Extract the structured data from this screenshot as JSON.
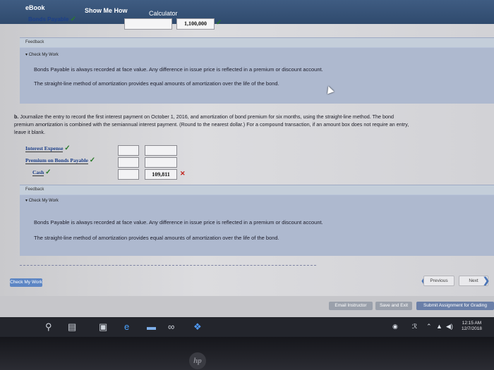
{
  "topbar": {
    "ebook": "eBook",
    "show_me_how": "Show Me How",
    "calculator": "Calculator"
  },
  "prev_entry": {
    "label": "Bonds Payable",
    "amount": "1,100,000"
  },
  "feedback_a": {
    "header": "Feedback",
    "check_my_work": "Check My Work",
    "line1": "Bonds Payable is always recorded at face value. Any difference in issue price is reflected in a premium or discount account.",
    "line2": "The straight-line method of amortization provides equal amounts of amortization over the life of the bond."
  },
  "question_b": {
    "prefix": "b.",
    "line1": "Journalize the entry to record the first interest payment on October 1, 2016, and amortization of bond premium for six months, using the straight-line method. The bond",
    "line2": "premium amortization is combined with the semiannual interest payment. (Round to the nearest dollar.) For a compound transaction, if an amount box does not require an entry,",
    "line3": "leave it blank."
  },
  "journal": {
    "rows": [
      {
        "account": "Interest Expense",
        "debit": "",
        "credit": ""
      },
      {
        "account": "Premium on Bonds Payable",
        "debit": "",
        "credit": ""
      },
      {
        "account": "Cash",
        "debit": "",
        "credit": "109,811"
      }
    ]
  },
  "feedback_b": {
    "header": "Feedback",
    "check_my_work": "Check My Work",
    "line1": "Bonds Payable is always recorded at face value. Any difference in issue price is reflected in a premium or discount account.",
    "line2": "The straight-line method of amortization provides equal amounts of amortization over the life of the bond."
  },
  "buttons": {
    "check_my_work": "Check My Work",
    "previous": "Previous",
    "next": "Next",
    "email_instructor": "Email Instructor",
    "save_and_exit": "Save and Exit",
    "submit": "Submit Assignment for Grading"
  },
  "taskbar": {
    "time": "12:15 AM",
    "date": "12/7/2018"
  },
  "colors": {
    "topbar": "#2f4a6d",
    "feedback": "#aeb9cf",
    "check_green": "#2a7a2a",
    "error_red": "#c0201a",
    "link_blue": "#1c3f8a"
  }
}
